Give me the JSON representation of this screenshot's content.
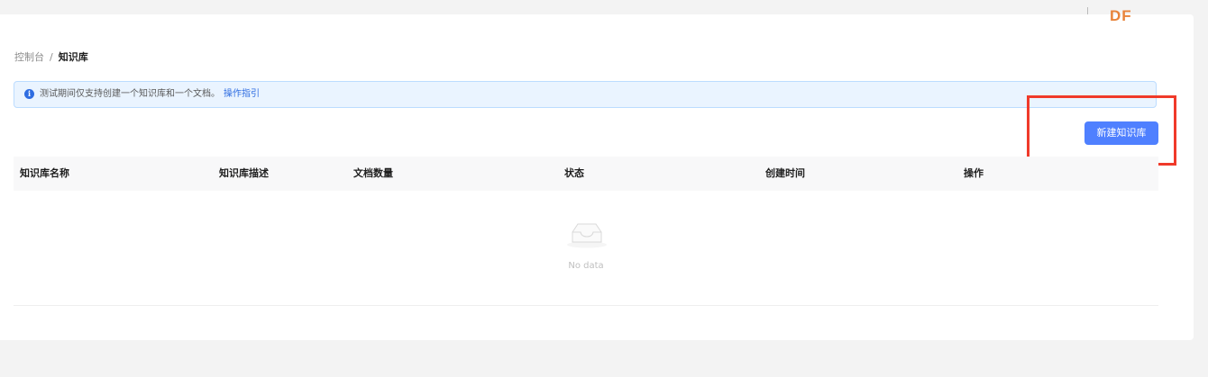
{
  "watermark": {
    "text": "DF"
  },
  "breadcrumb": {
    "items": [
      "控制台",
      "知识库"
    ],
    "separator": "/"
  },
  "alert": {
    "icon": "info-icon",
    "message": "测试期间仅支持创建一个知识库和一个文档。",
    "link_text": "操作指引"
  },
  "toolbar": {
    "new_button_label": "新建知识库"
  },
  "table": {
    "columns": [
      "知识库名称",
      "知识库描述",
      "文档数量",
      "状态",
      "创建时间",
      "操作"
    ],
    "rows": [],
    "empty_text": "No data",
    "empty_icon": "empty-inbox-icon"
  },
  "colors": {
    "accent": "#4f80ff",
    "link": "#2f6de1",
    "highlight": "#f03a2a",
    "watermark": "#e8833a",
    "alert_bg": "#eaf4ff",
    "alert_border": "#bcdcff"
  }
}
